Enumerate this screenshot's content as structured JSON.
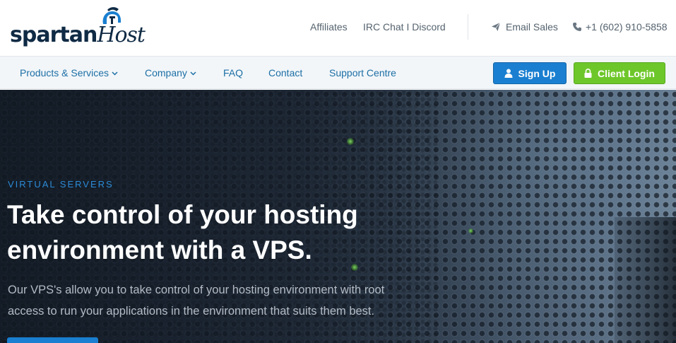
{
  "brand": {
    "logo_main": "spartan",
    "logo_script": "Host"
  },
  "topbar": {
    "links": [
      {
        "label": "Affiliates"
      },
      {
        "label": "IRC Chat I Discord"
      }
    ],
    "contact": {
      "email_label": "Email Sales",
      "phone_label": "+1 (602) 910-5858"
    }
  },
  "nav": {
    "items": [
      {
        "label": "Products & Services",
        "dropdown": true
      },
      {
        "label": "Company",
        "dropdown": true
      },
      {
        "label": "FAQ",
        "dropdown": false
      },
      {
        "label": "Contact",
        "dropdown": false
      },
      {
        "label": "Support Centre",
        "dropdown": false
      }
    ],
    "signup_label": "Sign Up",
    "login_label": "Client Login"
  },
  "hero": {
    "kicker": "VIRTUAL SERVERS",
    "title_line1": "Take control of your hosting",
    "title_line2": "environment with a VPS.",
    "body_line1": "Our VPS's allow you to take control of your hosting environment with root",
    "body_line2": "access to run your applications in the environment that suits them best."
  },
  "colors": {
    "primary_blue": "#1a7fd0",
    "login_green": "#6ec72a",
    "nav_text": "#1d6fa5",
    "brand_navy": "#0f2a44"
  },
  "icons": {
    "logo": "spartan-helmet-icon",
    "email": "paper-plane-icon",
    "phone": "phone-icon",
    "dropdown": "chevron-down-icon",
    "signup": "user-icon",
    "login": "lock-icon"
  }
}
